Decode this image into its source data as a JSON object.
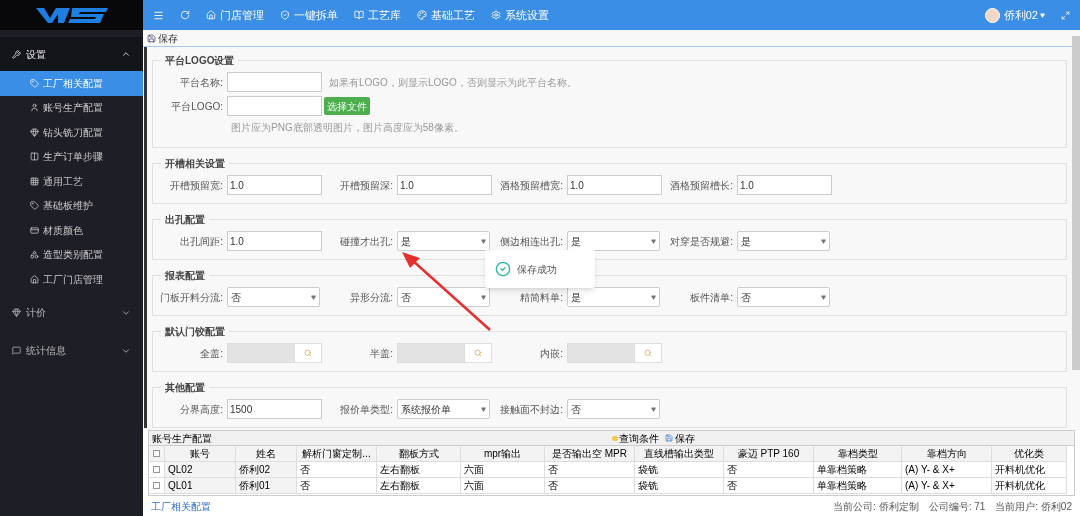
{
  "topbar": {
    "nav": [
      {
        "label": "门店管理"
      },
      {
        "label": "一键拆单"
      },
      {
        "label": "工艺库"
      },
      {
        "label": "基础工艺"
      },
      {
        "label": "系统设置"
      }
    ],
    "user": "侨利02"
  },
  "sidebar": {
    "groups": [
      {
        "label": "设置",
        "expanded": true,
        "items": [
          {
            "label": "工厂相关配置",
            "selected": true
          },
          {
            "label": "账号生产配置",
            "selected": false
          },
          {
            "label": "钻头铣刀配置",
            "selected": false
          },
          {
            "label": "生产订单步骤",
            "selected": false
          },
          {
            "label": "通用工艺",
            "selected": false
          },
          {
            "label": "基础板维护",
            "selected": false
          },
          {
            "label": "材质颜色",
            "selected": false
          },
          {
            "label": "造型类别配置",
            "selected": false
          },
          {
            "label": "工厂门店管理",
            "selected": false
          }
        ]
      },
      {
        "label": "计价",
        "expanded": false
      },
      {
        "label": "统计信息",
        "expanded": false
      }
    ]
  },
  "toolbar": {
    "save": "保存"
  },
  "sections": [
    {
      "title": "平台LOGO设置",
      "rows": [
        [
          {
            "kind": "text",
            "label": "平台名称:",
            "hint": "如果有LOGO，则显示LOGO，否则显示为此平台名称。"
          }
        ],
        [
          {
            "kind": "file",
            "label": "平台LOGO:",
            "button": "选择文件"
          }
        ]
      ],
      "note": "图片应为PNG底部透明图片，图片高度应为58像素。"
    },
    {
      "title": "开槽相关设置",
      "rows": [
        [
          {
            "kind": "text",
            "label": "开槽预留宽:",
            "value": "1.0"
          },
          {
            "kind": "text",
            "label": "开槽预留深:",
            "value": "1.0"
          },
          {
            "kind": "text",
            "label": "酒格预留槽宽:",
            "value": "1.0"
          },
          {
            "kind": "text",
            "label": "酒格预留槽长:",
            "value": "1.0"
          }
        ]
      ]
    },
    {
      "title": "出孔配置",
      "rows": [
        [
          {
            "kind": "text",
            "label": "出孔间距:",
            "value": "1.0"
          },
          {
            "kind": "select",
            "label": "碰撞才出孔:",
            "value": "是"
          },
          {
            "kind": "select",
            "label": "侧边相连出孔:",
            "value": "是"
          },
          {
            "kind": "select",
            "label": "对穿是否规避:",
            "value": "是"
          }
        ]
      ]
    },
    {
      "title": "报表配置",
      "rows": [
        [
          {
            "kind": "select",
            "label": "门板开料分流:",
            "value": "否"
          },
          {
            "kind": "select",
            "label": "异形分流:",
            "value": "否"
          },
          {
            "kind": "select",
            "label": "精简料单:",
            "value": "是"
          },
          {
            "kind": "select",
            "label": "板件清单:",
            "value": "否"
          }
        ]
      ]
    },
    {
      "title": "默认门铰配置",
      "rows": [
        [
          {
            "kind": "lookup",
            "label": "全盖:"
          },
          {
            "kind": "lookup",
            "label": "半盖:"
          },
          {
            "kind": "lookup",
            "label": "内嵌:"
          }
        ]
      ]
    },
    {
      "title": "其他配置",
      "rows": [
        [
          {
            "kind": "text",
            "label": "分界高度:",
            "value": "1500"
          },
          {
            "kind": "select",
            "label": "报价单类型:",
            "value": "系统报价单"
          },
          {
            "kind": "select",
            "label": "接触面不封边:",
            "value": "否"
          }
        ]
      ]
    }
  ],
  "toast": {
    "message": "保存成功"
  },
  "table": {
    "title": "账号生产配置",
    "all_selected": false,
    "query": "查询条件",
    "save": "保存",
    "columns": [
      "账号",
      "姓名",
      "解析门窗定制...",
      "翻板方式",
      "mpr输出",
      "是否输出空 MPR",
      "直线槽输出类型",
      "豪迈 PTP 160",
      "靠档类型",
      "靠档方向",
      "优化类"
    ],
    "rows": [
      {
        "selected": false,
        "cells": [
          "QL02",
          "侨利02",
          "否",
          "左右翻板",
          "六面",
          "否",
          "袋铣",
          "否",
          "单靠档策略",
          "(A) Y- & X+",
          "开料机优化"
        ]
      },
      {
        "selected": false,
        "cells": [
          "QL01",
          "侨利01",
          "否",
          "左右翻板",
          "六面",
          "否",
          "袋铣",
          "否",
          "单靠档策略",
          "(A) Y- & X+",
          "开料机优化"
        ]
      }
    ]
  },
  "status_bar": {
    "link": "工厂相关配置",
    "company": "当前公司: 侨利定制",
    "company_no": "公司编号: 71",
    "user": "当前用户: 侨利02"
  }
}
